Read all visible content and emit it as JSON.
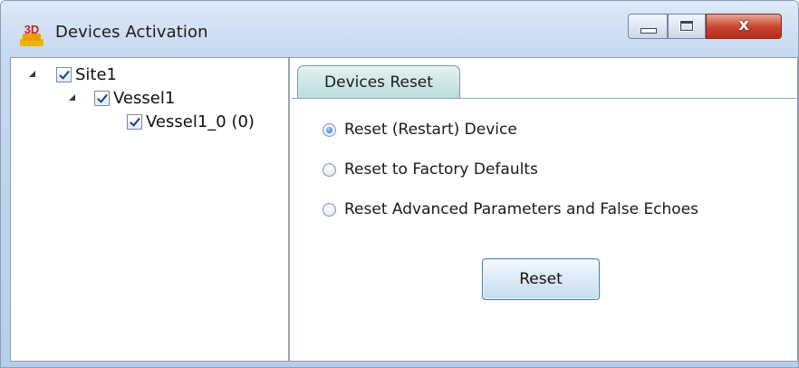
{
  "window": {
    "title": "Devices Activation",
    "icon": "3D",
    "controls": {
      "minimize": "minimize",
      "maximize": "maximize",
      "close": "x"
    }
  },
  "tree": {
    "items": [
      {
        "label": "Site1",
        "checked": true,
        "expanded": true
      },
      {
        "label": "Vessel1",
        "checked": true,
        "expanded": true
      },
      {
        "label": "Vessel1_0 (0)",
        "checked": true
      }
    ]
  },
  "tabs": [
    {
      "label": "Devices Reset",
      "selected": true
    }
  ],
  "reset_options": [
    {
      "label": "Reset (Restart) Device",
      "selected": true
    },
    {
      "label": "Reset to Factory Defaults",
      "selected": false
    },
    {
      "label": "Reset Advanced Parameters and False Echoes",
      "selected": false
    }
  ],
  "reset_button": {
    "label": "Reset"
  },
  "colors": {
    "accent": "#1f62b8",
    "tab_bg": "#bcdcdc",
    "close_button": "#c7422d"
  }
}
